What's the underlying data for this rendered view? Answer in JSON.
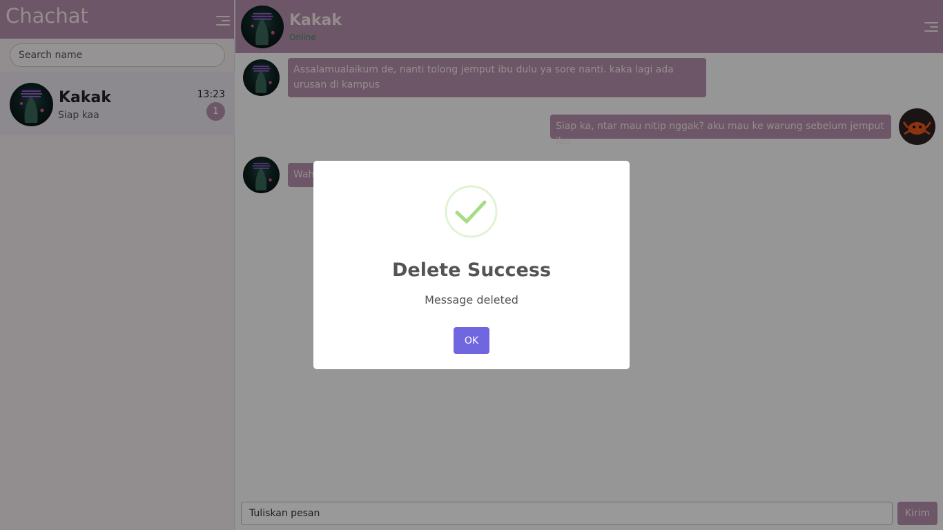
{
  "sidebar": {
    "app_title": "Chachat",
    "menu_icon": "hamburger-menu-icon",
    "search": {
      "placeholder": "Search name",
      "value": ""
    },
    "contacts": [
      {
        "name": "Kakak",
        "preview": "Siap kaa",
        "time": "13:23",
        "unread": "1",
        "avatar_icon": "contact-avatar"
      }
    ]
  },
  "chat": {
    "header": {
      "name": "Kakak",
      "status": "Online",
      "menu_icon": "hamburger-menu-icon"
    },
    "messages": [
      {
        "from": "contact",
        "text": "Assalamualaikum de, nanti tolong jemput ibu dulu ya sore nanti. kaka lagi ada urusan di kampus"
      },
      {
        "from": "me",
        "text": "Siap ka, ntar mau nitip nggak? aku mau ke warung sebelum jemput ibu"
      },
      {
        "from": "contact",
        "text": "Wah"
      }
    ],
    "composer": {
      "placeholder": "Tuliskan pesan",
      "value": "",
      "send_label": "Kirim"
    }
  },
  "modal": {
    "icon": "success-check-icon",
    "title": "Delete Success",
    "text": "Message deleted",
    "ok_label": "OK",
    "colors": {
      "button": "#7066e0",
      "check": "#a5dc86"
    }
  },
  "theme": {
    "primary": "#b48fad",
    "header_text": "#f7ece8"
  }
}
